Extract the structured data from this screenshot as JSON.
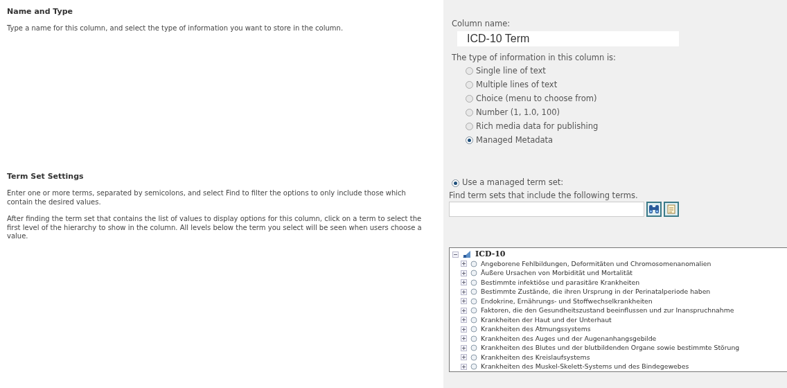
{
  "sections": [
    {
      "title": "Name and Type",
      "paragraphs": [
        "Type a name for this column, and select the type of information you want to store in the column."
      ]
    },
    {
      "title": "Term Set Settings",
      "paragraphs": [
        "Enter one or more terms, separated by semicolons, and select Find to filter the options to only include those which contain the desired values.",
        "After finding the term set that contains the list of values to display options for this column, click on a term to select the first level of the hierarchy to show in the column. All levels below the term you select will be seen when users choose a value."
      ]
    }
  ],
  "column_name": {
    "label": "Column name:",
    "value": "ICD-10 Term"
  },
  "type_label": "The type of information in this column is:",
  "type_options": [
    {
      "label": "Single line of text",
      "selected": false
    },
    {
      "label": "Multiple lines of text",
      "selected": false
    },
    {
      "label": "Choice (menu to choose from)",
      "selected": false
    },
    {
      "label": "Number (1, 1.0, 100)",
      "selected": false
    },
    {
      "label": "Rich media data for publishing",
      "selected": false
    },
    {
      "label": "Managed Metadata",
      "selected": true
    }
  ],
  "term_set": {
    "option": {
      "label": "Use a managed term set:",
      "selected": true
    },
    "find_label": "Find term sets that include the following terms.",
    "tree": {
      "label": "ICD-10",
      "expanded": true,
      "children": [
        {
          "label": "Angeborene Fehlbildungen, Deformitäten und Chromosomenanomalien",
          "expanded": false
        },
        {
          "label": "Äußere Ursachen von Morbidität und Mortalität",
          "expanded": false
        },
        {
          "label": "Bestimmte infektiöse und parasitäre Krankheiten",
          "expanded": false
        },
        {
          "label": "Bestimmte Zustände, die ihren Ursprung in der Perinatalperiode haben",
          "expanded": false
        },
        {
          "label": "Endokrine, Ernährungs- und Stoffwechselkrankheiten",
          "expanded": false
        },
        {
          "label": "Faktoren, die den Gesundheitszustand beeinflussen und zur Inanspruchnahme",
          "expanded": false
        },
        {
          "label": "Krankheiten der Haut und der Unterhaut",
          "expanded": false
        },
        {
          "label": "Krankheiten des Atmungssystems",
          "expanded": false
        },
        {
          "label": "Krankheiten des Auges und der Augenanhangsgebilde",
          "expanded": false
        },
        {
          "label": "Krankheiten des Blutes und der blutbildenden Organe sowie bestimmte Störung",
          "expanded": false
        },
        {
          "label": "Krankheiten des Kreislaufsystems",
          "expanded": false
        },
        {
          "label": "Krankheiten des Muskel-Skelett-Systems und des Bindegewebes",
          "expanded": false
        }
      ]
    }
  }
}
